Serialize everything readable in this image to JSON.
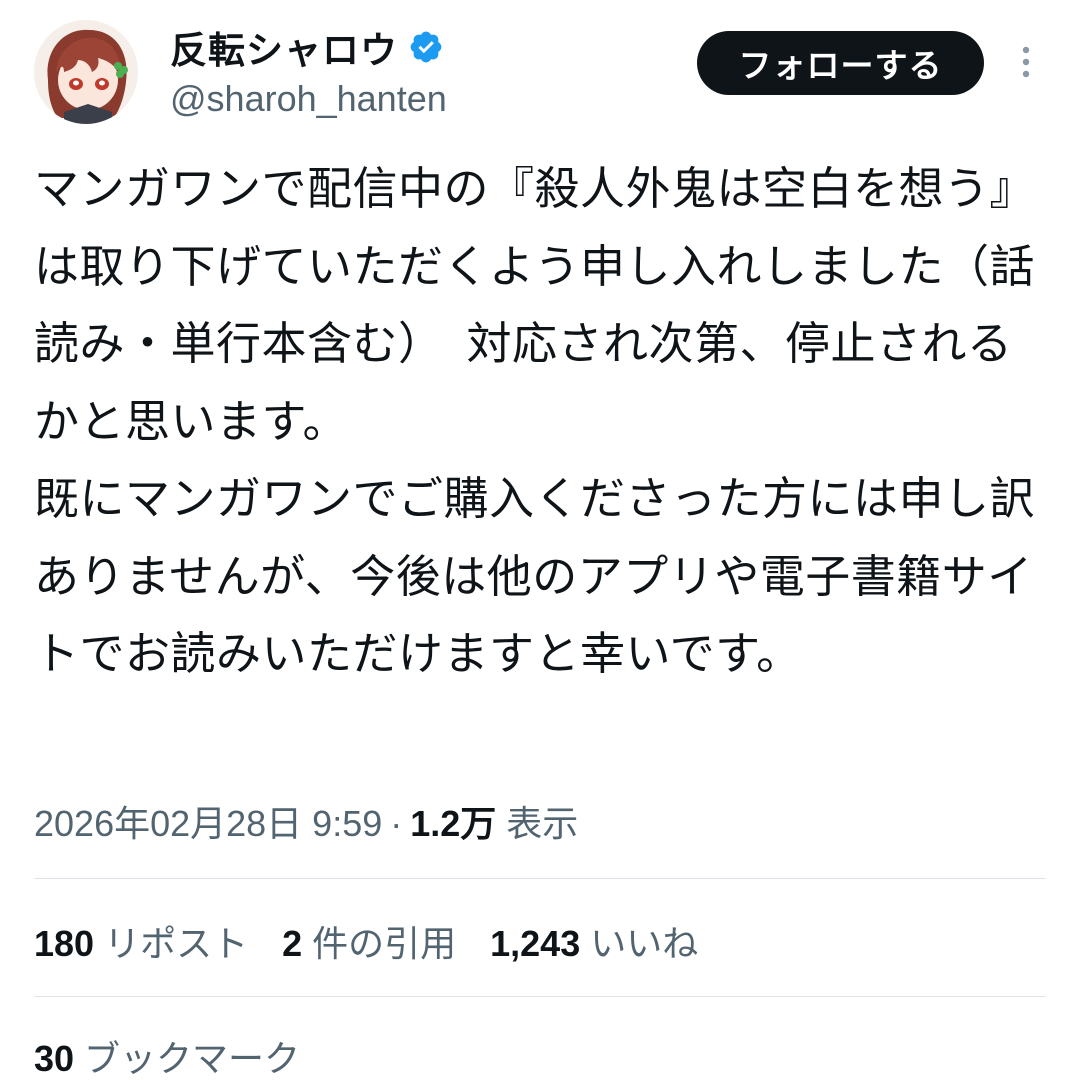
{
  "author": {
    "display_name": "反転シャロウ",
    "handle": "@sharoh_hanten",
    "verified": true,
    "avatar_icon": "avatar-illustration-icon"
  },
  "follow_button": {
    "label": "フォローする"
  },
  "more_icon": "more-vertical-icon",
  "tweet": {
    "text": "マンガワンで配信中の『殺人外鬼は空白を想う』は取り下げていただくよう申し入れしました（話読み・単行本含む）　対応され次第、停止されるかと思います。\n既にマンガワンでご購入くださった方には申し訳ありませんが、今後は他のアプリや電子書籍サイトでお読みいただけますと幸いです。"
  },
  "meta": {
    "timestamp": "2026年02月28日 9:59",
    "separator": "·",
    "views_count": "1.2万",
    "views_label": "表示"
  },
  "stats": {
    "reposts": {
      "count": "180",
      "label": "リポスト"
    },
    "quotes": {
      "count": "2",
      "label": "件の引用"
    },
    "likes": {
      "count": "1,243",
      "label": "いいね"
    },
    "bookmarks": {
      "count": "30",
      "label": "ブックマーク"
    }
  },
  "colors": {
    "text_primary": "#0f1419",
    "text_secondary": "#536471",
    "verified_blue": "#1d9bf0",
    "divider": "#dde3e8",
    "follow_bg": "#0f1419"
  }
}
